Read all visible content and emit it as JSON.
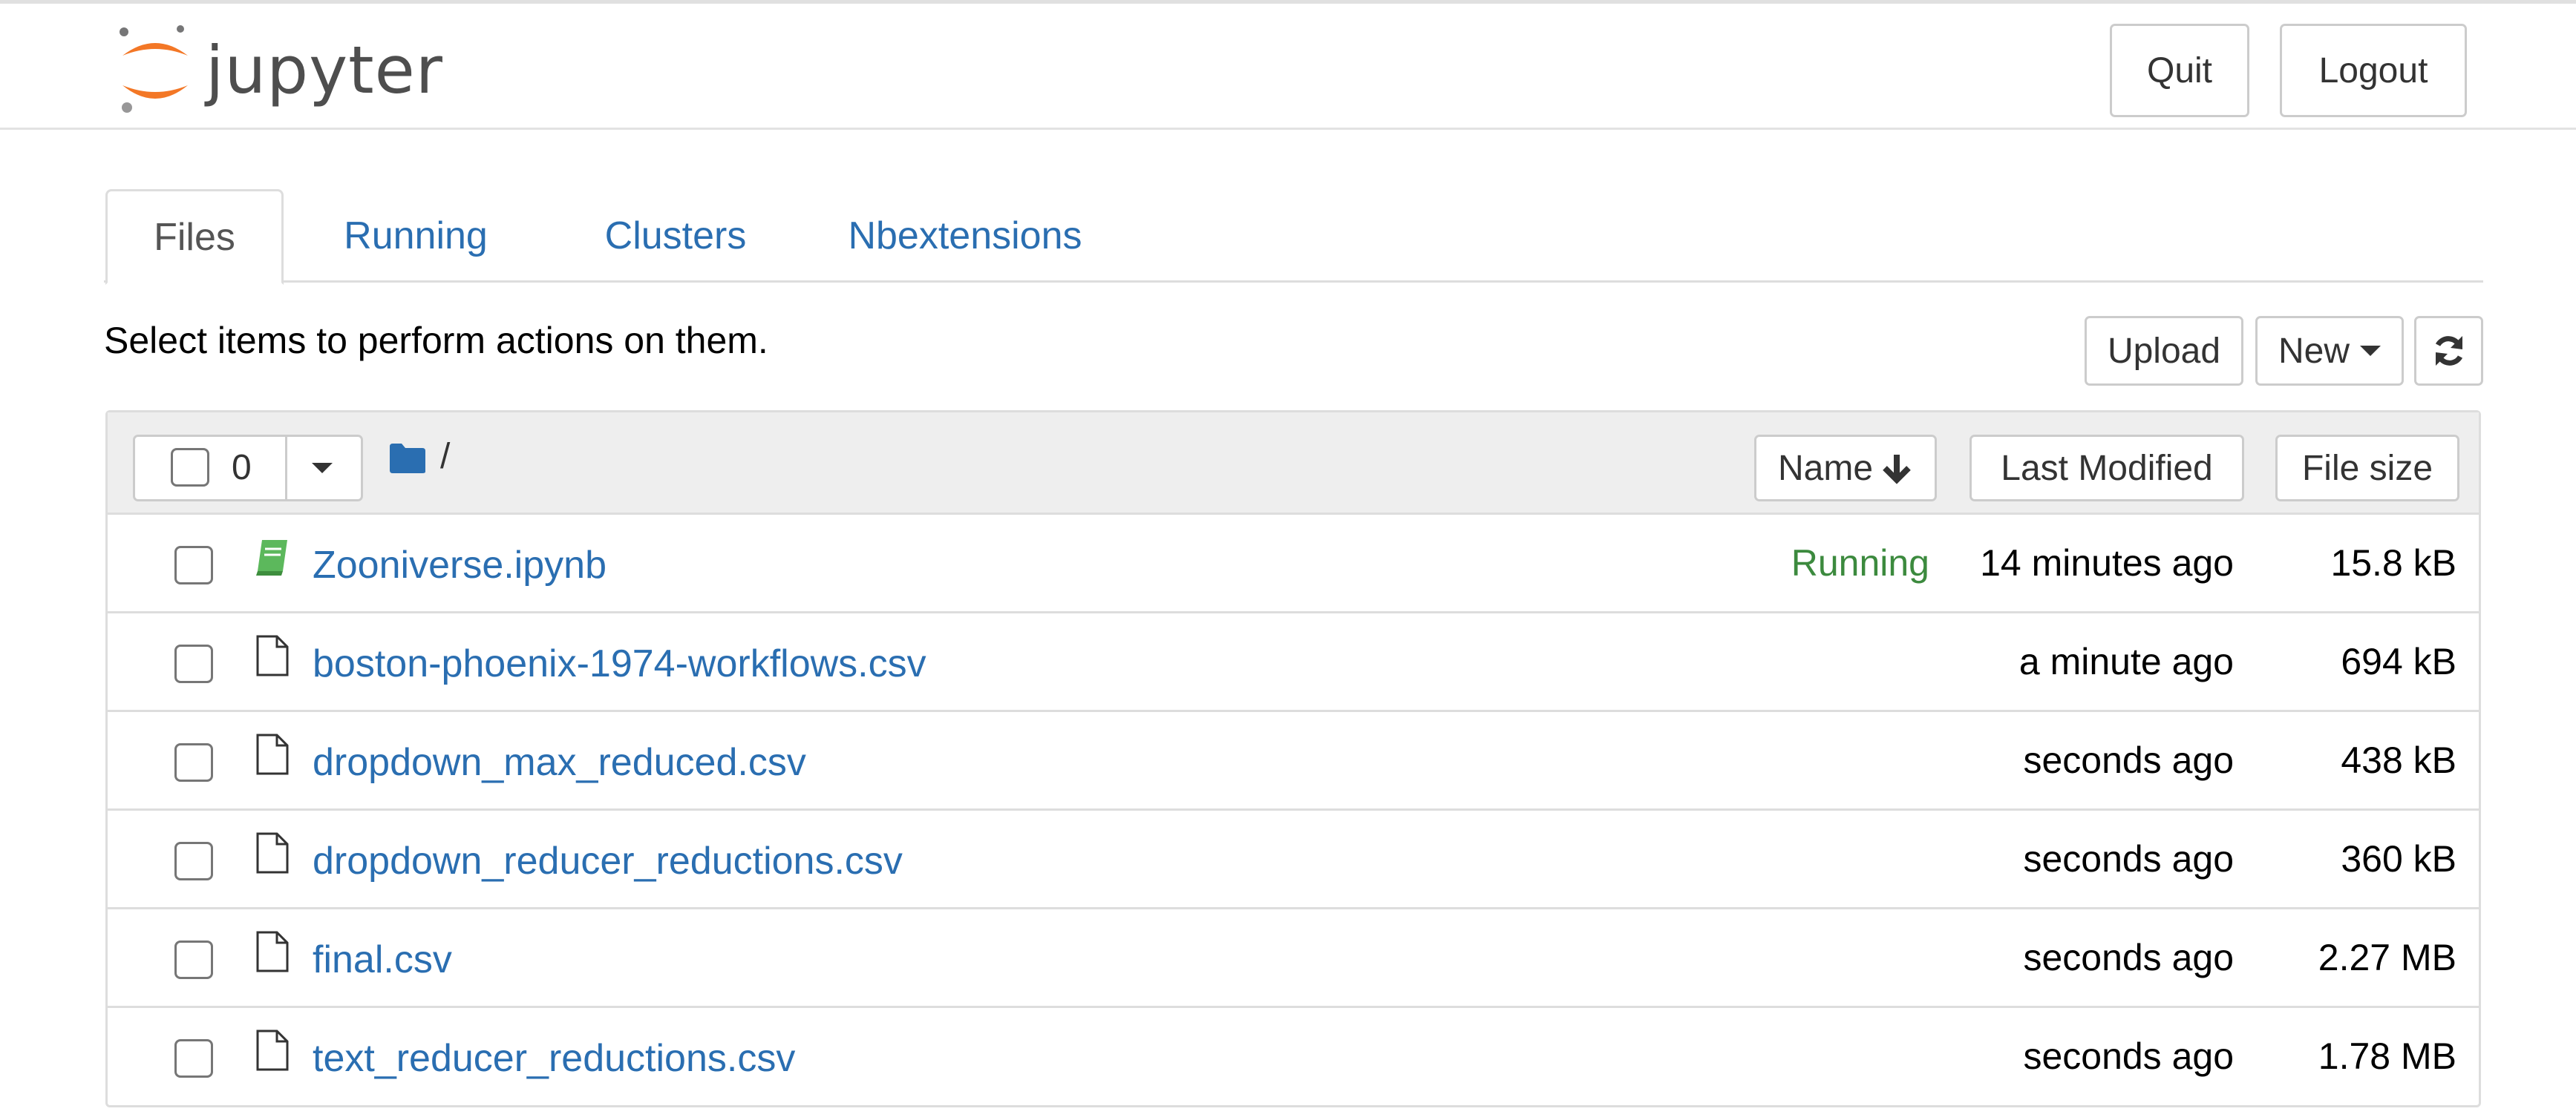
{
  "header": {
    "logo_text": "jupyter",
    "quit_label": "Quit",
    "logout_label": "Logout"
  },
  "tabs": [
    {
      "label": "Files",
      "active": true
    },
    {
      "label": "Running",
      "active": false
    },
    {
      "label": "Clusters",
      "active": false
    },
    {
      "label": "Nbextensions",
      "active": false
    }
  ],
  "toolbar": {
    "instructions": "Select items to perform actions on them.",
    "upload_label": "Upload",
    "new_label": "New",
    "refresh_icon": "refresh-icon"
  },
  "list_header": {
    "selected_count": "0",
    "path": "/",
    "sort_name_label": "Name",
    "sort_modified_label": "Last Modified",
    "sort_size_label": "File size"
  },
  "files": [
    {
      "name": "Zooniverse.ipynb",
      "type": "notebook",
      "status": "Running",
      "modified": "14 minutes ago",
      "size": "15.8 kB"
    },
    {
      "name": "boston-phoenix-1974-workflows.csv",
      "type": "file",
      "status": "",
      "modified": "a minute ago",
      "size": "694 kB"
    },
    {
      "name": "dropdown_max_reduced.csv",
      "type": "file",
      "status": "",
      "modified": "seconds ago",
      "size": "438 kB"
    },
    {
      "name": "dropdown_reducer_reductions.csv",
      "type": "file",
      "status": "",
      "modified": "seconds ago",
      "size": "360 kB"
    },
    {
      "name": "final.csv",
      "type": "file",
      "status": "",
      "modified": "seconds ago",
      "size": "2.27 MB"
    },
    {
      "name": "text_reducer_reductions.csv",
      "type": "file",
      "status": "",
      "modified": "seconds ago",
      "size": "1.78 MB"
    }
  ],
  "colors": {
    "link": "#2a6eb1",
    "running": "#3c8a3e",
    "notebook_icon": "#5cb85c",
    "logo_orange": "#f37726"
  }
}
